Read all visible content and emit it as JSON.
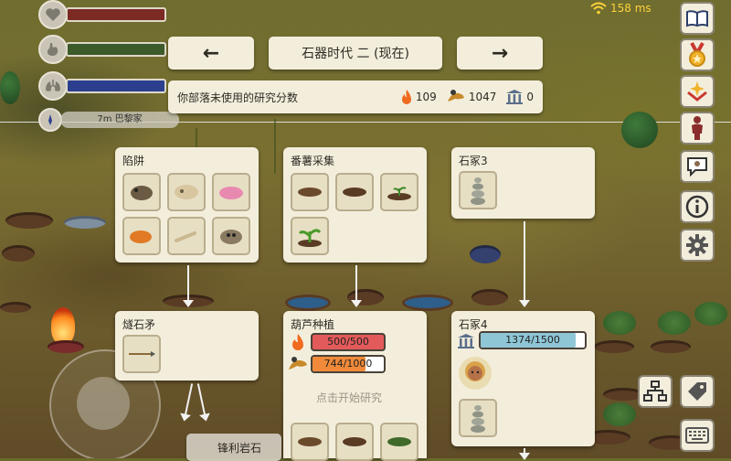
{
  "ping": {
    "value": "158 ms",
    "color": "#ffd23a"
  },
  "hud": {
    "distance_text": "7m 巴黎家",
    "bars": [
      {
        "icon": "heart-icon",
        "fill_color": "#7b2a24",
        "level_pct": 100
      },
      {
        "icon": "stomach-icon",
        "fill_color": "#3d5a2a",
        "level_pct": 100
      },
      {
        "icon": "lungs-icon",
        "fill_color": "#2c3f8f",
        "level_pct": 100
      }
    ]
  },
  "nav": {
    "prev_label": "←",
    "next_label": "→",
    "era_title": "石器时代 二 (现在)"
  },
  "research_points": {
    "label": "你部落未使用的研究分数",
    "fire_value": "109",
    "food_value": "1047",
    "knowledge_value": "0"
  },
  "cards": {
    "trap": {
      "title": "陷阱"
    },
    "yam": {
      "title": "番薯采集"
    },
    "cairn3": {
      "title": "石冢3"
    },
    "flint_spear": {
      "title": "燧石矛"
    },
    "gourd": {
      "title": "葫芦种植",
      "fire_progress": "500/500",
      "fire_progress_fraction": 1.0,
      "food_progress": "744/1000",
      "food_progress_fraction": 0.744,
      "hint": "点击开始研究"
    },
    "cairn4": {
      "title": "石冢4",
      "knowledge_progress": "1374/1500",
      "knowledge_progress_fraction": 0.916
    }
  },
  "bottom_label": "锋利岩石",
  "colors": {
    "panel_bg": "#f3eedc",
    "fire_bar": "#e35a5a",
    "food_bar": "#f08a3a",
    "knowledge_bar": "#8ec6d6"
  }
}
